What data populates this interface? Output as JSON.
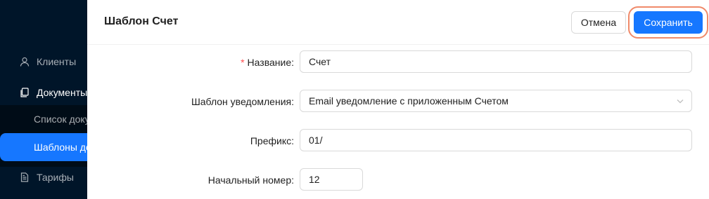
{
  "sidebar": {
    "items": [
      {
        "label": "Клиенты",
        "icon": "user-icon"
      },
      {
        "label": "Документы",
        "icon": "file-copy-icon"
      },
      {
        "label": "Тарифы",
        "icon": "file-text-icon"
      }
    ],
    "sub_items": [
      {
        "label": "Список документов"
      },
      {
        "label": "Шаблоны документов"
      }
    ]
  },
  "drawer": {
    "title": "Шаблон Счет",
    "cancel_label": "Отмена",
    "save_label": "Сохранить"
  },
  "form": {
    "name": {
      "label": "Название",
      "colon": ":",
      "required_mark": "*",
      "value": "Счет"
    },
    "notification_template": {
      "label": "Шаблон уведомления",
      "colon": ":",
      "value": "Email уведомление с приложенным Счетом"
    },
    "prefix": {
      "label": "Префикс",
      "colon": ":",
      "value": "01/"
    },
    "start_number": {
      "label": "Начальный номер",
      "colon": ":",
      "value": "12"
    }
  },
  "colors": {
    "primary": "#1677ff",
    "sidebar_bg": "#001529",
    "highlight_ring": "#f08a6a",
    "required": "#ff4d4f"
  }
}
